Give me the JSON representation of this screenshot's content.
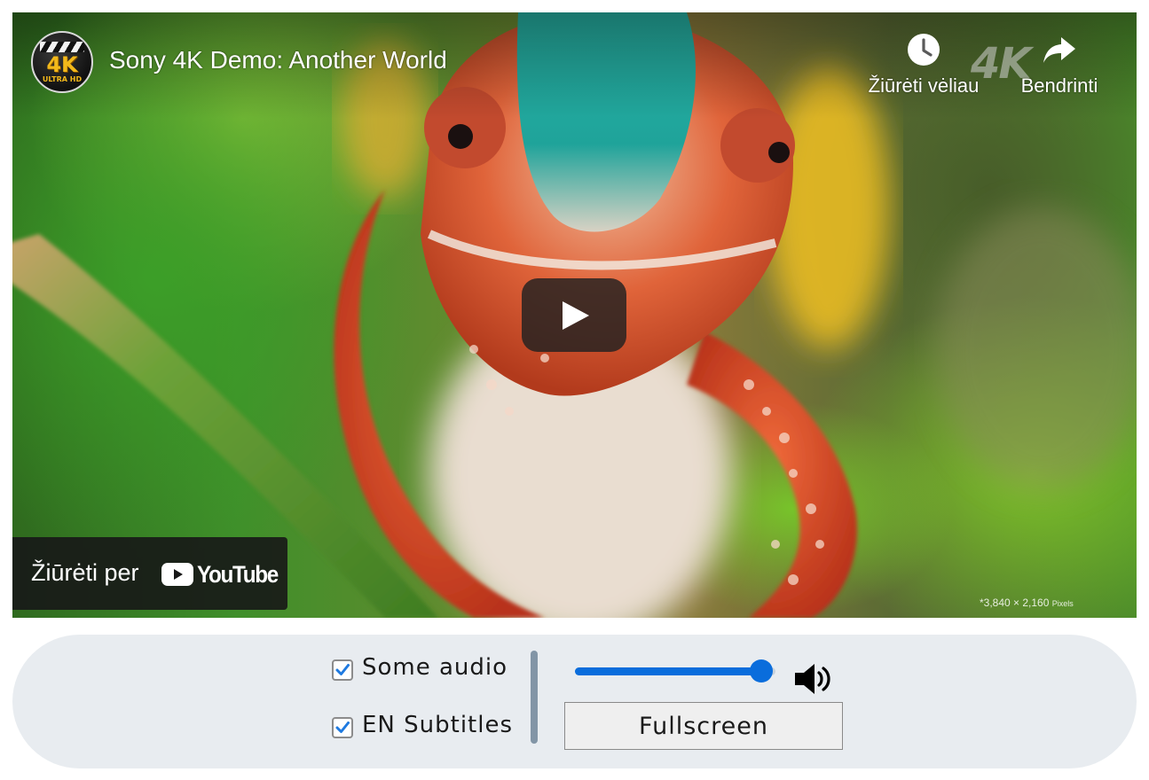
{
  "video": {
    "title": "Sony 4K Demo: Another World",
    "channel_logo_text": "4K",
    "channel_logo_subtext": "ULTRA HD",
    "watermark": "4K",
    "watch_later_label": "Žiūrėti vėliau",
    "share_label": "Bendrinti",
    "watch_on_label": "Žiūrėti per",
    "youtube_wordmark": "YouTube",
    "pixels_note": "*3,840 × 2,160",
    "pixels_note_unit": "Pixels"
  },
  "controls": {
    "audio_label": "Some audio",
    "audio_checked": true,
    "subtitles_label": "EN Subtitles",
    "subtitles_checked": true,
    "volume_percent": 93,
    "fullscreen_label": "Fullscreen"
  },
  "icons": {
    "watch_later": "clock-icon",
    "share": "share-arrow-icon",
    "play": "play-icon",
    "volume": "speaker-volume-icon",
    "check": "checkmark-icon"
  },
  "colors": {
    "accent": "#0a6ddc",
    "control_bar_bg": "#e8ecf0",
    "divider": "#8295a6",
    "player_overlay": "#212121"
  }
}
